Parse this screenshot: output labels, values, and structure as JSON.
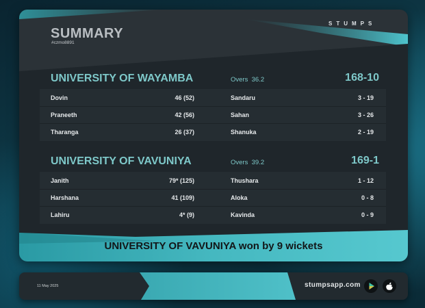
{
  "header": {
    "title": "SUMMARY",
    "match_id": "#czmo8891",
    "brand": "STUMPS"
  },
  "innings": [
    {
      "team": "UNIVERSITY OF WAYAMBA",
      "overs_label": "Overs",
      "overs": "36.2",
      "score": "168-10",
      "rows": [
        {
          "batter": "Dovin",
          "runs": "46 (52)",
          "bowler": "Sandaru",
          "figures": "3 - 19"
        },
        {
          "batter": "Praneeth",
          "runs": "42 (56)",
          "bowler": "Sahan",
          "figures": "3 - 26"
        },
        {
          "batter": "Tharanga",
          "runs": "26 (37)",
          "bowler": "Shanuka",
          "figures": "2 - 19"
        }
      ]
    },
    {
      "team": "UNIVERSITY OF VAVUNIYA",
      "overs_label": "Overs",
      "overs": "39.2",
      "score": "169-1",
      "rows": [
        {
          "batter": "Janith",
          "runs": "79* (125)",
          "bowler": "Thushara",
          "figures": "1 - 12"
        },
        {
          "batter": "Harshana",
          "runs": "41 (109)",
          "bowler": "Aloka",
          "figures": "0 - 8"
        },
        {
          "batter": "Lahiru",
          "runs": "4* (9)",
          "bowler": "Kavinda",
          "figures": "0 - 9"
        }
      ]
    }
  ],
  "result": "UNIVERSITY OF VAVUNIYA won by 9 wickets",
  "footer": {
    "date": "11 May 2025",
    "url": "stumpsapp.com",
    "icons": [
      "play-store-icon",
      "apple-icon"
    ]
  },
  "colors": {
    "accent": "#7ec8c9",
    "teal_band": "#3fb0b8",
    "card": "#1f262b"
  }
}
